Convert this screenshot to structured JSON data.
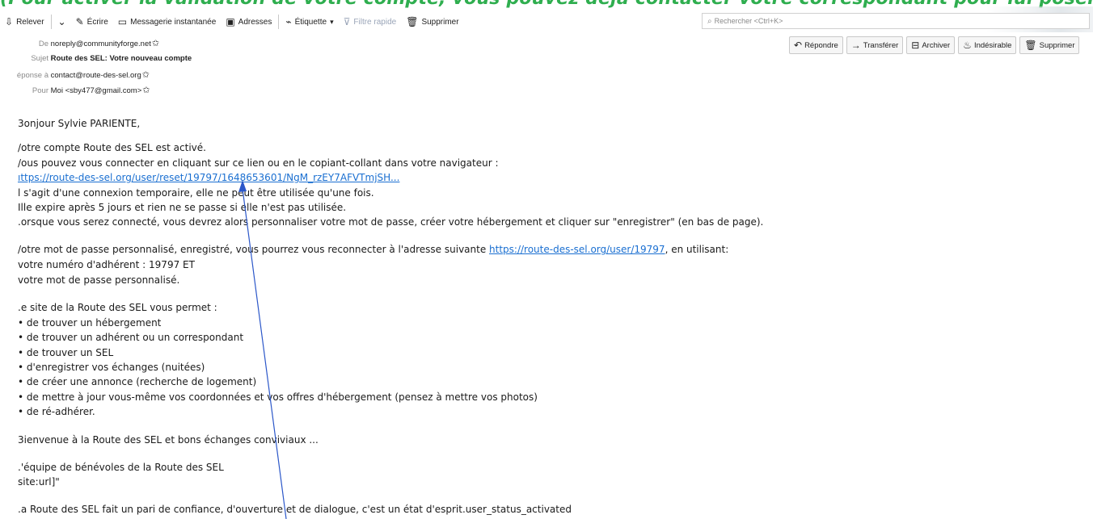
{
  "banner": {
    "text": "(Pour activer la validation de votre compte, vous pouvez déjà contacter votre correspondant pour lui poser"
  },
  "toolbar": {
    "items": [
      {
        "label": "Relever",
        "icon": "get-mail-icon"
      },
      {
        "label": "",
        "icon": "chevron-down-icon"
      },
      {
        "label": "Écrire",
        "icon": "pen-icon"
      },
      {
        "label": "Messagerie instantanée",
        "icon": "chat-icon"
      },
      {
        "label": "Adresses",
        "icon": "address-book-icon"
      },
      {
        "label": "Étiquette",
        "icon": "tag-icon"
      },
      {
        "label": "Filtre rapide",
        "icon": "filter-icon"
      },
      {
        "label": "Supprimer",
        "icon": "trash-icon"
      }
    ],
    "search_placeholder": "Rechercher <Ctrl+K>"
  },
  "header": {
    "from_label": "De",
    "from_value": "noreply@communityforge.net",
    "subject_label": "Sujet",
    "subject_value": "Route des SEL: Votre nouveau compte",
    "replyto_label": "éponse à",
    "replyto_value": "contact@route-des-sel.org",
    "to_label": "Pour",
    "to_value": "Moi <sby477@gmail.com>"
  },
  "actions": [
    {
      "label": "Répondre",
      "icon": "reply-icon"
    },
    {
      "label": "Transférer",
      "icon": "forward-icon"
    },
    {
      "label": "Archiver",
      "icon": "archive-icon"
    },
    {
      "label": "Indésirable",
      "icon": "junk-icon"
    },
    {
      "label": "Supprimer",
      "icon": "trash-icon"
    }
  ],
  "message": {
    "greeting": "3onjour Sylvie PARIENTE,",
    "p1": "/otre compte Route des SEL est activé.",
    "p2": "/ous pouvez vous connecter en cliquant sur ce lien ou en le copiant-collant dans votre navigateur :",
    "reset_link": "ıttps://route-des-sel.org/user/reset/19797/1648653601/NgM_rzEY7AFVTmjSH...",
    "p3": "l s'agit d'une connexion temporaire, elle ne peut être utilisée qu'une fois.",
    "p4": "Ille expire après 5 jours et rien ne se passe si elle n'est pas utilisée.",
    "p5": ".orsque vous serez connecté, vous devrez alors personnaliser votre mot de passe, créer votre hébergement et cliquer sur \"enregistrer\" (en bas de page).",
    "p6_before": "/otre mot de passe personnalisé, enregistré, vous pourrez vous reconnecter à l'adresse suivante ",
    "p6_link": "https://route-des-sel.org/user/19797",
    "p6_after": ", en utilisant:",
    "p7": "votre numéro d'adhérent : 19797 ET",
    "p8": "votre mot de passe personnalisé.",
    "p9": ".e site de la Route des SEL vous permet :",
    "bullets": [
      "• de trouver un hébergement",
      "• de trouver un adhérent ou un correspondant",
      "• de trouver un SEL",
      "• d'enregistrer vos échanges (nuitées)",
      "• de créer une annonce (recherche de logement)",
      "• de mettre à jour vous-même vos coordonnées et vos offres d'hébergement (pensez à mettre vos photos)",
      "• de ré-adhérer."
    ],
    "p10": "3ienvenue à la Route des SEL et bons échanges conviviaux ...",
    "p11": ".'équipe de bénévoles de la Route des SEL",
    "p12": "site:url]\"",
    "p13": ".a Route des SEL fait un pari de confiance, d'ouverture et de dialogue, c'est un état d'esprit.user_status_activated"
  },
  "colors": {
    "banner": "#2fae4f",
    "link": "#1a6fd1",
    "arrow": "#2b57c9"
  }
}
